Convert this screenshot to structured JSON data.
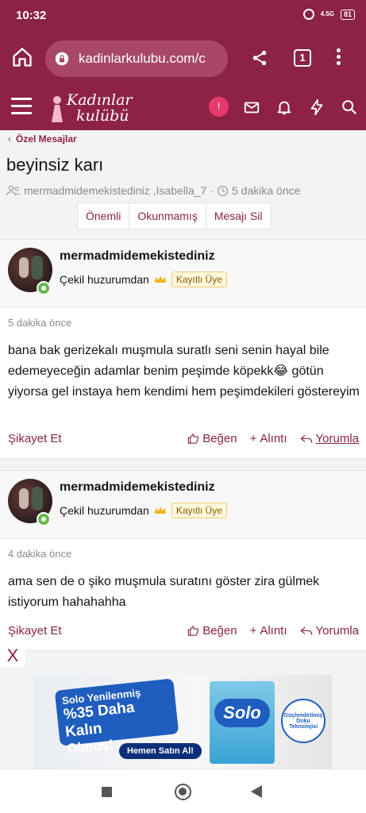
{
  "status": {
    "time": "10:32",
    "network": "4.5G",
    "battery": "81"
  },
  "browser": {
    "url": "kadinlarkulubu.com/c",
    "tab_count": "1"
  },
  "site": {
    "logo_line1": "Kadınlar",
    "logo_line2": "kulübü",
    "notification_count": "!"
  },
  "breadcrumb": {
    "label": "Özel Mesajlar"
  },
  "conversation": {
    "title": "beyinsiz karı",
    "participants": "mermadmidemekistediniz ,Isabella_7",
    "time": "5 dakika önce"
  },
  "actions": {
    "important": "Önemli",
    "unread": "Okunmamış",
    "delete": "Mesajı Sil"
  },
  "messages": [
    {
      "username": "mermadmidemekistediniz",
      "user_title": "Çekil huzurumdan",
      "rank": "Kayıtlı Üye",
      "time": "5 dakika önce",
      "text": "bana bak gerizekalı muşmula suratlı seni senin hayal bile edemeyeceğin adamlar benim peşimde köpekk😂 götün yiyorsa gel instaya hem kendimi hem peşimdekileri göstereyim",
      "report": "Şikayet Et",
      "like": "Beğen",
      "quote": "Alıntı",
      "reply": "Yorumla"
    },
    {
      "username": "mermadmidemekistediniz",
      "user_title": "Çekil huzurumdan",
      "rank": "Kayıtlı Üye",
      "time": "4 dakika önce",
      "text": "ama sen de o şiko muşmula suratını göster zira gülmek istiyorum hahahahha",
      "report": "Şikayet Et",
      "like": "Beğen",
      "quote": "Alıntı",
      "reply": "Yorumla"
    }
  ],
  "ad": {
    "close": "X",
    "line1": "Solo Yenilenmiş",
    "line2": "%35 Daha Kalın",
    "line3": "Olmuş!",
    "cta": "Hemen Satın Al!",
    "brand": "Solo",
    "seal": "Güçlendirilmiş Doku Teknolojisi"
  }
}
